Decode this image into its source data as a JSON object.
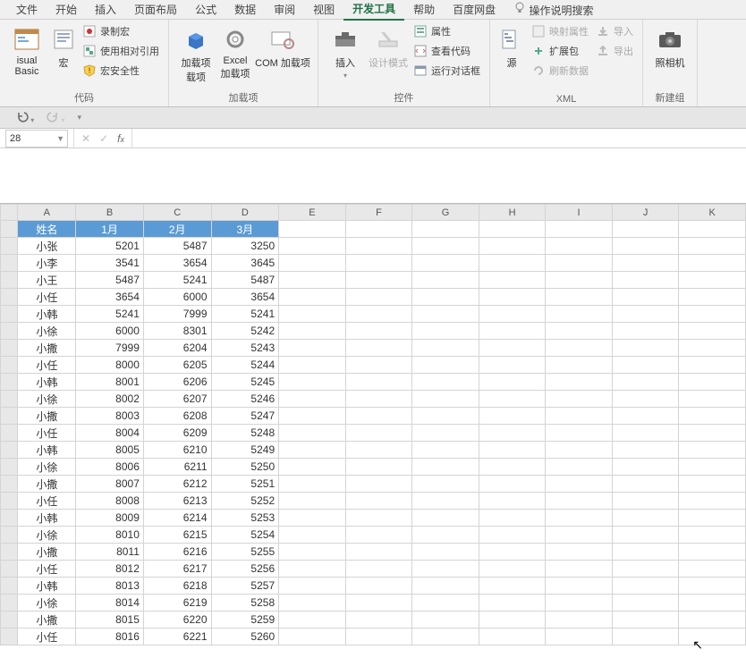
{
  "tabs": {
    "items": [
      "文件",
      "开始",
      "插入",
      "页面布局",
      "公式",
      "数据",
      "审阅",
      "视图",
      "开发工具",
      "帮助",
      "百度网盘"
    ],
    "active": "开发工具",
    "tell_me": "操作说明搜索"
  },
  "ribbon": {
    "code": {
      "vb": "isual Basic",
      "macro": "宏",
      "record": "录制宏",
      "relative": "使用相对引用",
      "security": "宏安全性",
      "label": "代码"
    },
    "addins": {
      "addin": "加载项",
      "addin2": "载项",
      "excel": "Excel",
      "excel2": "加载项",
      "com": "COM 加载项",
      "label": "加载项"
    },
    "controls": {
      "insert": "插入",
      "design": "设计模式",
      "prop": "属性",
      "viewcode": "查看代码",
      "rundlg": "运行对话框",
      "label": "控件"
    },
    "xml": {
      "source": "源",
      "mapprop": "映射属性",
      "expand": "扩展包",
      "refresh": "刷新数据",
      "import": "导入",
      "export": "导出",
      "label": "XML"
    },
    "newgrp": {
      "camera": "照相机",
      "label": "新建组"
    }
  },
  "name_box": "28",
  "sheet": {
    "headers": [
      "姓名",
      "1月",
      "2月",
      "3月"
    ],
    "cols": [
      "A",
      "B",
      "C",
      "D",
      "E",
      "F",
      "G",
      "H",
      "I",
      "J",
      "K"
    ],
    "rows": [
      {
        "name": "小张",
        "v": [
          5201,
          5487,
          3250
        ]
      },
      {
        "name": "小李",
        "v": [
          3541,
          3654,
          3645
        ]
      },
      {
        "name": "小王",
        "v": [
          5487,
          5241,
          5487
        ]
      },
      {
        "name": "小任",
        "v": [
          3654,
          6000,
          3654
        ]
      },
      {
        "name": "小韩",
        "v": [
          5241,
          7999,
          5241
        ]
      },
      {
        "name": "小徐",
        "v": [
          6000,
          8301,
          5242
        ]
      },
      {
        "name": "小撒",
        "v": [
          7999,
          6204,
          5243
        ]
      },
      {
        "name": "小任",
        "v": [
          8000,
          6205,
          5244
        ]
      },
      {
        "name": "小韩",
        "v": [
          8001,
          6206,
          5245
        ]
      },
      {
        "name": "小徐",
        "v": [
          8002,
          6207,
          5246
        ]
      },
      {
        "name": "小撒",
        "v": [
          8003,
          6208,
          5247
        ]
      },
      {
        "name": "小任",
        "v": [
          8004,
          6209,
          5248
        ]
      },
      {
        "name": "小韩",
        "v": [
          8005,
          6210,
          5249
        ]
      },
      {
        "name": "小徐",
        "v": [
          8006,
          6211,
          5250
        ]
      },
      {
        "name": "小撒",
        "v": [
          8007,
          6212,
          5251
        ]
      },
      {
        "name": "小任",
        "v": [
          8008,
          6213,
          5252
        ]
      },
      {
        "name": "小韩",
        "v": [
          8009,
          6214,
          5253
        ]
      },
      {
        "name": "小徐",
        "v": [
          8010,
          6215,
          5254
        ]
      },
      {
        "name": "小撒",
        "v": [
          8011,
          6216,
          5255
        ]
      },
      {
        "name": "小任",
        "v": [
          8012,
          6217,
          5256
        ]
      },
      {
        "name": "小韩",
        "v": [
          8013,
          6218,
          5257
        ]
      },
      {
        "name": "小徐",
        "v": [
          8014,
          6219,
          5258
        ]
      },
      {
        "name": "小撒",
        "v": [
          8015,
          6220,
          5259
        ]
      },
      {
        "name": "小任",
        "v": [
          8016,
          6221,
          5260
        ]
      }
    ]
  }
}
